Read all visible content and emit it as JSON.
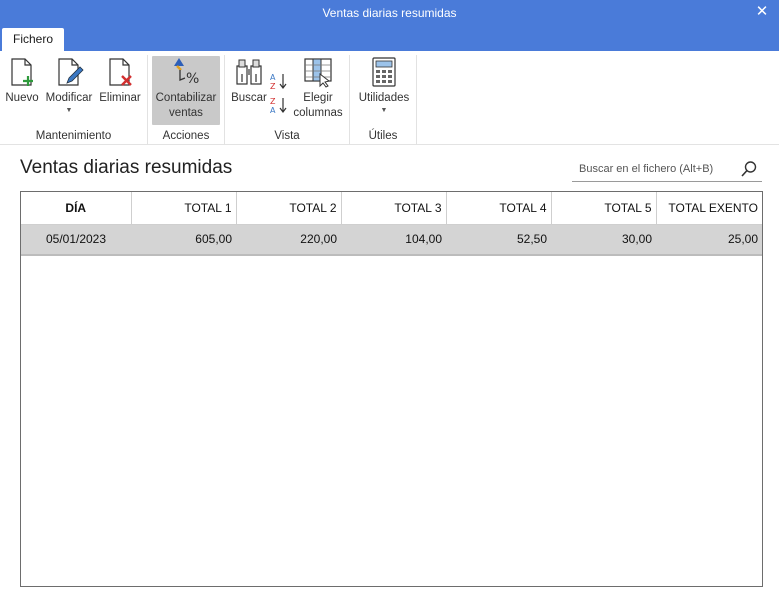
{
  "window": {
    "title": "Ventas diarias resumidas",
    "close_glyph": "✕"
  },
  "tabs": [
    {
      "label": "Fichero",
      "active": true
    }
  ],
  "ribbon": {
    "groups": [
      {
        "label": "Mantenimiento",
        "buttons": [
          {
            "label": "Nuevo",
            "icon": "new-document-icon"
          },
          {
            "label": "Modificar",
            "icon": "edit-document-icon",
            "has_dropdown": true
          },
          {
            "label": "Eliminar",
            "icon": "delete-document-icon"
          }
        ]
      },
      {
        "label": "Acciones",
        "buttons": [
          {
            "label_line1": "Contabilizar",
            "label_line2": "ventas",
            "icon": "accounting-percent-icon",
            "active": true
          }
        ]
      },
      {
        "label": "Vista",
        "buttons": [
          {
            "label": "Buscar",
            "icon": "binoculars-icon"
          },
          {
            "icon": "sort-ascending-icon",
            "label": ""
          },
          {
            "icon": "sort-descending-icon",
            "label": ""
          },
          {
            "label_line1": "Elegir",
            "label_line2": "columnas",
            "icon": "choose-columns-icon"
          }
        ]
      },
      {
        "label": "Útiles",
        "buttons": [
          {
            "label": "Utilidades",
            "icon": "calculator-icon",
            "has_dropdown": true
          }
        ]
      }
    ]
  },
  "main": {
    "title": "Ventas diarias resumidas",
    "search": {
      "placeholder": "Buscar en el fichero (Alt+B)",
      "value": ""
    }
  },
  "table": {
    "columns": [
      "DÍA",
      "TOTAL 1",
      "TOTAL 2",
      "TOTAL 3",
      "TOTAL 4",
      "TOTAL 5",
      "TOTAL EXENTO"
    ],
    "rows": [
      [
        "05/01/2023",
        "605,00",
        "220,00",
        "104,00",
        "52,50",
        "30,00",
        "25,00"
      ]
    ]
  },
  "colors": {
    "accent": "#4a7bd9",
    "selected_row": "#d4d4d4",
    "active_button": "#c9c9c9"
  }
}
